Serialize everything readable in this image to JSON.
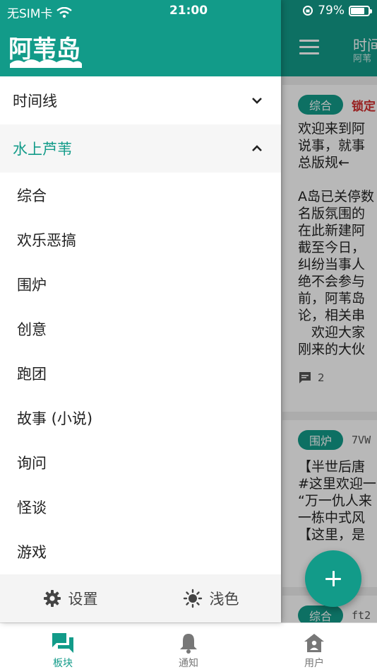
{
  "status_bar": {
    "carrier": "无SIM卡",
    "time": "21:00",
    "battery": "79%",
    "battery_level": 0.79
  },
  "main": {
    "title": "时间",
    "subtitle": "阿苇",
    "cards": [
      {
        "tag": "综合",
        "badge": "锁定",
        "lines": [
          {
            "text": "欢迎来到阿",
            "style": "normal"
          },
          {
            "text": "说事，就事",
            "style": "normal"
          },
          {
            "text": "总版规←",
            "style": "teal"
          }
        ],
        "lines2": [
          {
            "text": "A岛已关停数",
            "style": "normal"
          },
          {
            "text": "名版氛围的",
            "style": "normal"
          },
          {
            "text": "在此新建阿",
            "style": "normal"
          },
          {
            "text": "截至今日，",
            "style": "red"
          },
          {
            "text": "纠纷当事人",
            "style": "red"
          },
          {
            "text": "绝不会参与",
            "style": "red"
          },
          {
            "text": "前，阿苇岛",
            "style": "red"
          },
          {
            "text": "论，相关串",
            "style": "red"
          },
          {
            "text": "　欢迎大家",
            "style": "normal"
          },
          {
            "text": "刚来的大伙",
            "style": "fade"
          }
        ],
        "replies": "2"
      },
      {
        "tag": "围炉",
        "uid": "7VW",
        "lines": [
          {
            "text": "【半世后唐",
            "style": "normal"
          },
          {
            "text": "#这里欢迎一",
            "style": "normal"
          },
          {
            "text": "“万一仇人来",
            "style": "normal"
          },
          {
            "text": "一栋中式风",
            "style": "normal"
          },
          {
            "text": "【这里，是",
            "style": "normal"
          }
        ]
      },
      {
        "tag": "综合",
        "uid": "ft2"
      }
    ]
  },
  "drawer": {
    "logo_text": "阿苇岛",
    "timeline_label": "时间线",
    "category_label": "水上芦苇",
    "boards": [
      "综合",
      "欢乐恶搞",
      "围炉",
      "创意",
      "跑团",
      "故事 (小说)",
      "询问",
      "怪谈",
      "游戏"
    ],
    "settings_label": "设置",
    "theme_label": "浅色"
  },
  "tabbar": {
    "boards": "板块",
    "notify": "通知",
    "user": "用户"
  },
  "colors": {
    "accent": "#129b89",
    "lock": "#d32f2f"
  }
}
